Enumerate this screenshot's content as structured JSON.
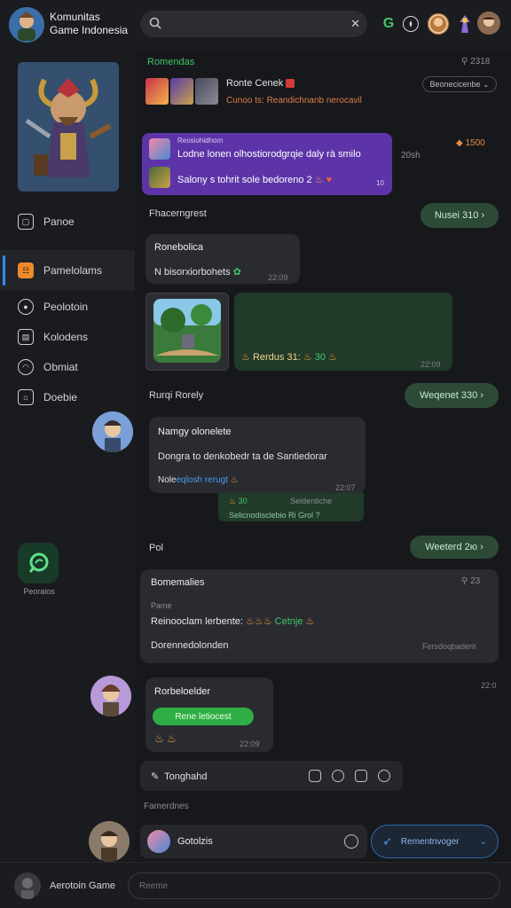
{
  "header": {
    "title_line1": "Komunitas",
    "title_line2": "Game Indonesia",
    "search_placeholder": "",
    "clear_glyph": "✕",
    "icons": [
      "g-icon",
      "compass-icon",
      "profile-avatar-1",
      "profile-avatar-2",
      "profile-avatar-3"
    ]
  },
  "sidebar": {
    "items": [
      {
        "label": "Panoe",
        "icon": "square-icon"
      },
      {
        "label": "Pamelolams",
        "icon": "grid-icon"
      },
      {
        "label": "Peolotoin",
        "icon": "user-icon"
      },
      {
        "label": "Kolodens",
        "icon": "chart-icon"
      },
      {
        "label": "Obmiat",
        "icon": "circle-icon"
      },
      {
        "label": "Doebie",
        "icon": "home-icon"
      }
    ],
    "app_label": "Peoraios"
  },
  "feed": {
    "top_section": {
      "label": "Romendas",
      "count": "2318",
      "title": "Ronte Cenek",
      "subtitle": "Cunoo ts: Reandichnanb nerocavil",
      "button": "Beonecicenbe"
    },
    "purple_card": {
      "name": "Reosiohidhom",
      "line1": "Lodne lonen olhostiorodgrqie daly rà smilo",
      "line2": "Salony s tohrit sole bedoreno 2",
      "count_label": "10",
      "side_count": "1500",
      "side_label": "20sh"
    },
    "section2": {
      "label": "Fhacerngrest",
      "pill": "Nusei 310"
    },
    "msg1": {
      "title": "Ronebolica",
      "text": "N bisorxiorbohets",
      "time": "22:09"
    },
    "image_msg": {
      "reaction": "Rerdus 31:",
      "count": "30",
      "time": "22:09"
    },
    "section3": {
      "label": "Rurqi Rorely",
      "pill": "Weqenet 330"
    },
    "msg2": {
      "title": "Namgy olonelete",
      "text": "Dongra to denkobedr ta de Santiedorar",
      "link_prefix": "Nole",
      "link": "eqlosh rerugt",
      "time": "22:07",
      "inline_count": "30",
      "inline_text": "Seidentiche",
      "inline_sub": "Selicnodisclebio Ri Grol ?"
    },
    "section4": {
      "label": "Pol",
      "pill": "Weeterd 2ю"
    },
    "msg3": {
      "title": "Bomemalies",
      "count": "23",
      "subtitle": "Pame",
      "line": "Reinooclam lerbente:",
      "line_green": "Cetnje",
      "footer": "Dorennedolonden",
      "footer_right": "Fersdoqbaderit"
    },
    "msg4": {
      "title": "Rorbeloelder",
      "button": "Rene letiocest",
      "time": "22:09",
      "side_time": "22:0"
    },
    "tool_input": {
      "label": "Tonghahd"
    },
    "typing_label": "Famerdnes",
    "composer": {
      "label": "Gotolzis",
      "button": "Rementnvoger"
    }
  },
  "bottom": {
    "user_label": "Aerotoin Game",
    "input_placeholder": "Reeme"
  },
  "colors": {
    "accent_green": "#3ec86a",
    "accent_blue": "#2e8ef0",
    "purple": "#5c34a8",
    "orange": "#f08a2a"
  }
}
